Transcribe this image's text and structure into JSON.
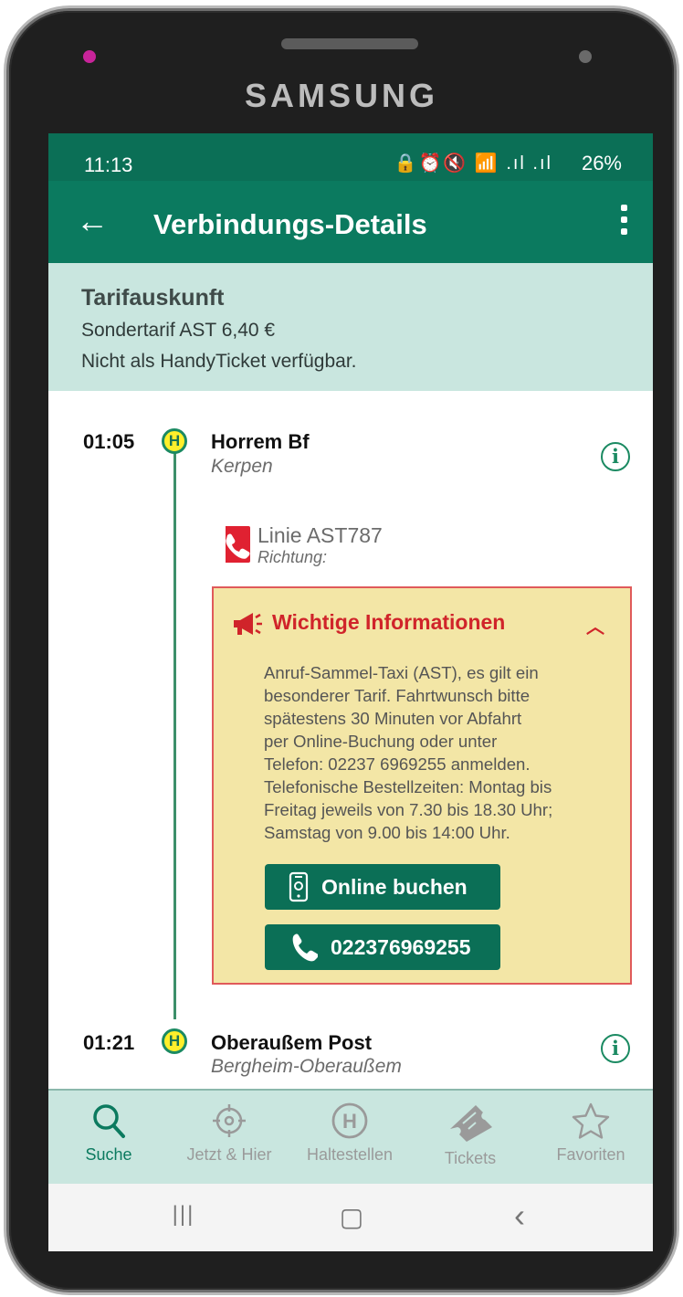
{
  "device": {
    "brand": "SAMSUNG"
  },
  "status_bar": {
    "time": "11:13",
    "icons": "🔒⏰🔇 📶 .ıl .ıl",
    "battery": "26%"
  },
  "app_bar": {
    "title": "Verbindungs-Details"
  },
  "tarif": {
    "title": "Tarifauskunft",
    "line1": "Sondertarif AST 6,40 €",
    "line2": "Nicht als HandyTicket verfügbar."
  },
  "departure": {
    "time": "01:05",
    "stop_badge": "H",
    "name": "Horrem Bf",
    "city": "Kerpen"
  },
  "line": {
    "name": "Linie AST787",
    "direction": "Richtung:"
  },
  "info_box": {
    "title": "Wichtige Informationen",
    "lines": [
      "Anruf-Sammel-Taxi (AST), es gilt ein",
      "besonderer Tarif. Fahrtwunsch bitte",
      "spätestens 30 Minuten vor Abfahrt",
      "per Online-Buchung oder unter",
      "Telefon: 02237 6969255 anmelden.",
      "Telefonische Bestellzeiten: Montag bis",
      "Freitag jeweils von 7.30 bis 18.30 Uhr;",
      "Samstag von 9.00 bis 14:00 Uhr."
    ],
    "online_button": "Online buchen",
    "phone_button": "022376969255"
  },
  "arrival": {
    "time": "01:21",
    "stop_badge": "H",
    "name": "Oberaußem Post",
    "city": "Bergheim-Oberaußem"
  },
  "bottom_nav": [
    {
      "label": "Suche",
      "icon": "search-icon",
      "active": true
    },
    {
      "label": "Jetzt & Hier",
      "icon": "location-crosshair-icon",
      "active": false
    },
    {
      "label": "Haltestellen",
      "icon": "stop-h-icon",
      "active": false
    },
    {
      "label": "Tickets",
      "icon": "ticket-icon",
      "active": false
    },
    {
      "label": "Favoriten",
      "icon": "star-icon",
      "active": false
    }
  ],
  "system_nav": {
    "recents": "|||",
    "home": "▢",
    "back": "‹"
  },
  "colors": {
    "primary": "#0b7a5f",
    "status": "#0b6f56",
    "tarif_bg": "#c9e6df",
    "warn_bg": "#f3e6a6",
    "warn_red": "#d0242a"
  }
}
